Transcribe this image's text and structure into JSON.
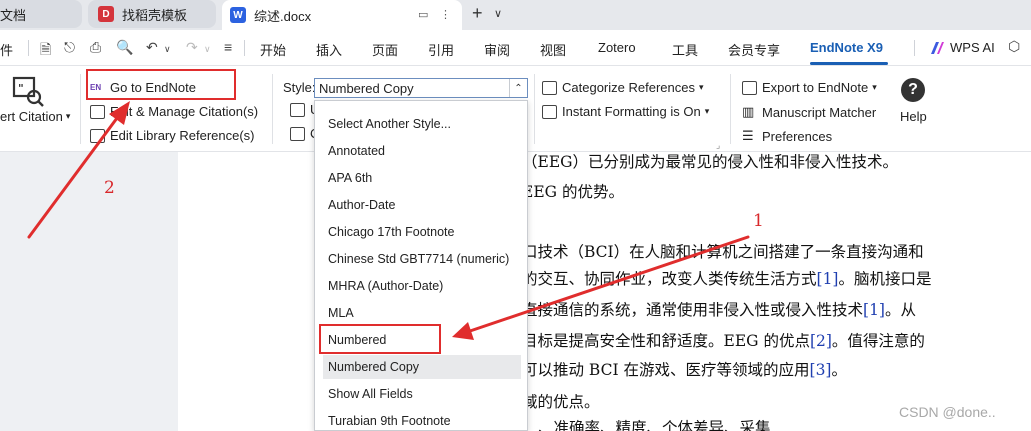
{
  "tabs": [
    {
      "label": "文档"
    },
    {
      "label": "找稻壳模板"
    },
    {
      "label": "综述.docx"
    }
  ],
  "menu": {
    "file": "件",
    "items": [
      "开始",
      "插入",
      "页面",
      "引用",
      "审阅",
      "视图",
      "Zotero",
      "工具",
      "会员专享"
    ],
    "active": "EndNote X9",
    "ai": "WPS AI"
  },
  "ribbon": {
    "insert_citation": "ert Citation",
    "go_to_endnote": "Go to EndNote",
    "edit_manage": "Edit & Manage Citation(s)",
    "edit_library": "Edit Library Reference(s)",
    "style_label": "Style:",
    "style_value": "Numbered Copy",
    "categorize": "Categorize References",
    "instant_formatting": "Instant Formatting is On",
    "export": "Export to EndNote",
    "manuscript": "Manuscript Matcher",
    "preferences": "Preferences",
    "help": "Help",
    "partial_u": "U",
    "partial_c": "C"
  },
  "dropdown": {
    "items": [
      "Select Another Style...",
      "Annotated",
      "APA 6th",
      "Author-Date",
      "Chicago 17th Footnote",
      "Chinese Std GBT7714 (numeric)",
      "MHRA (Author-Date)",
      "MLA",
      "Numbered",
      "Numbered Copy",
      "Show All Fields",
      "Turabian 9th Footnote"
    ]
  },
  "document": {
    "line1": "（EEG）已分别成为最常见的侵入性和非侵入性技术。",
    "line2": "EEG 的优势。",
    "line3": "口技术（BCI）在人脑和计算机之间搭建了一条直接沟通和",
    "line4a": "的交互、协同作业，改变人类传统生活方式",
    "line4cite": "[1]",
    "line4b": "。脑机接口是",
    "line5a": "直接通信的系统，通常使用非侵入性或侵入性技术",
    "line5cite": "[1]",
    "line5b": "。从",
    "line6a": "目标是提高安全性和舒适度。EEG 的优点",
    "line6cite": "[2]",
    "line6b": "。值得注意的",
    "line7a": "可以推动 BCI 在游戏、医疗等领域的应用",
    "line7cite": "[3]",
    "line7b": "。",
    "line8": "域的优点。",
    "line9": "、准确率、精度、个体差异、采集"
  },
  "annotations": {
    "label1": "1",
    "label2": "2"
  },
  "watermark": "CSDN @done..",
  "colors": {
    "accent": "#1a5fb4",
    "annotation": "#e02d2d"
  }
}
